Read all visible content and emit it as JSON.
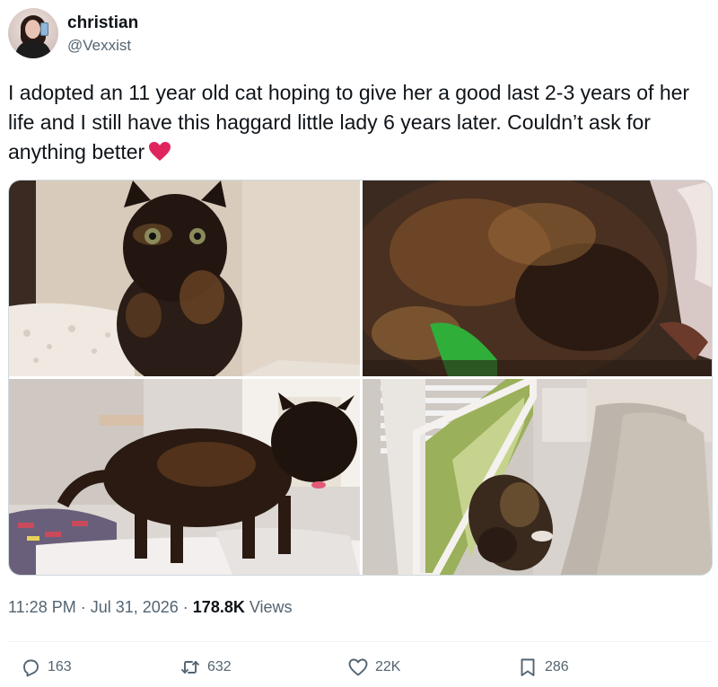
{
  "author": {
    "display_name": "christian",
    "handle": "@Vexxist",
    "avatar_icon": "user-avatar"
  },
  "tweet": {
    "text": "I adopted an 11 year old cat hoping to give her a good last 2-3 years of her life and I still have this haggard little lady 6 years later. Couldn’t ask for anything better",
    "emoji": "red-heart-emoji"
  },
  "media": {
    "photos": [
      {
        "subject": "tortoiseshell cat sitting"
      },
      {
        "subject": "tortoiseshell cat sleeping curled"
      },
      {
        "subject": "tortoiseshell cat standing on blanket"
      },
      {
        "subject": "tortoiseshell cat lying by window"
      }
    ]
  },
  "meta": {
    "time": "11:28 PM",
    "separator1": " · ",
    "date": "Jul 31, 2026",
    "separator2": " · ",
    "views_count": "178.8K",
    "views_label": " Views"
  },
  "actions": {
    "replies": "163",
    "reposts": "632",
    "likes": "22K",
    "bookmarks": "286"
  },
  "colors": {
    "text_primary": "#0f1419",
    "text_secondary": "#536471",
    "heart": "#e0245e"
  }
}
